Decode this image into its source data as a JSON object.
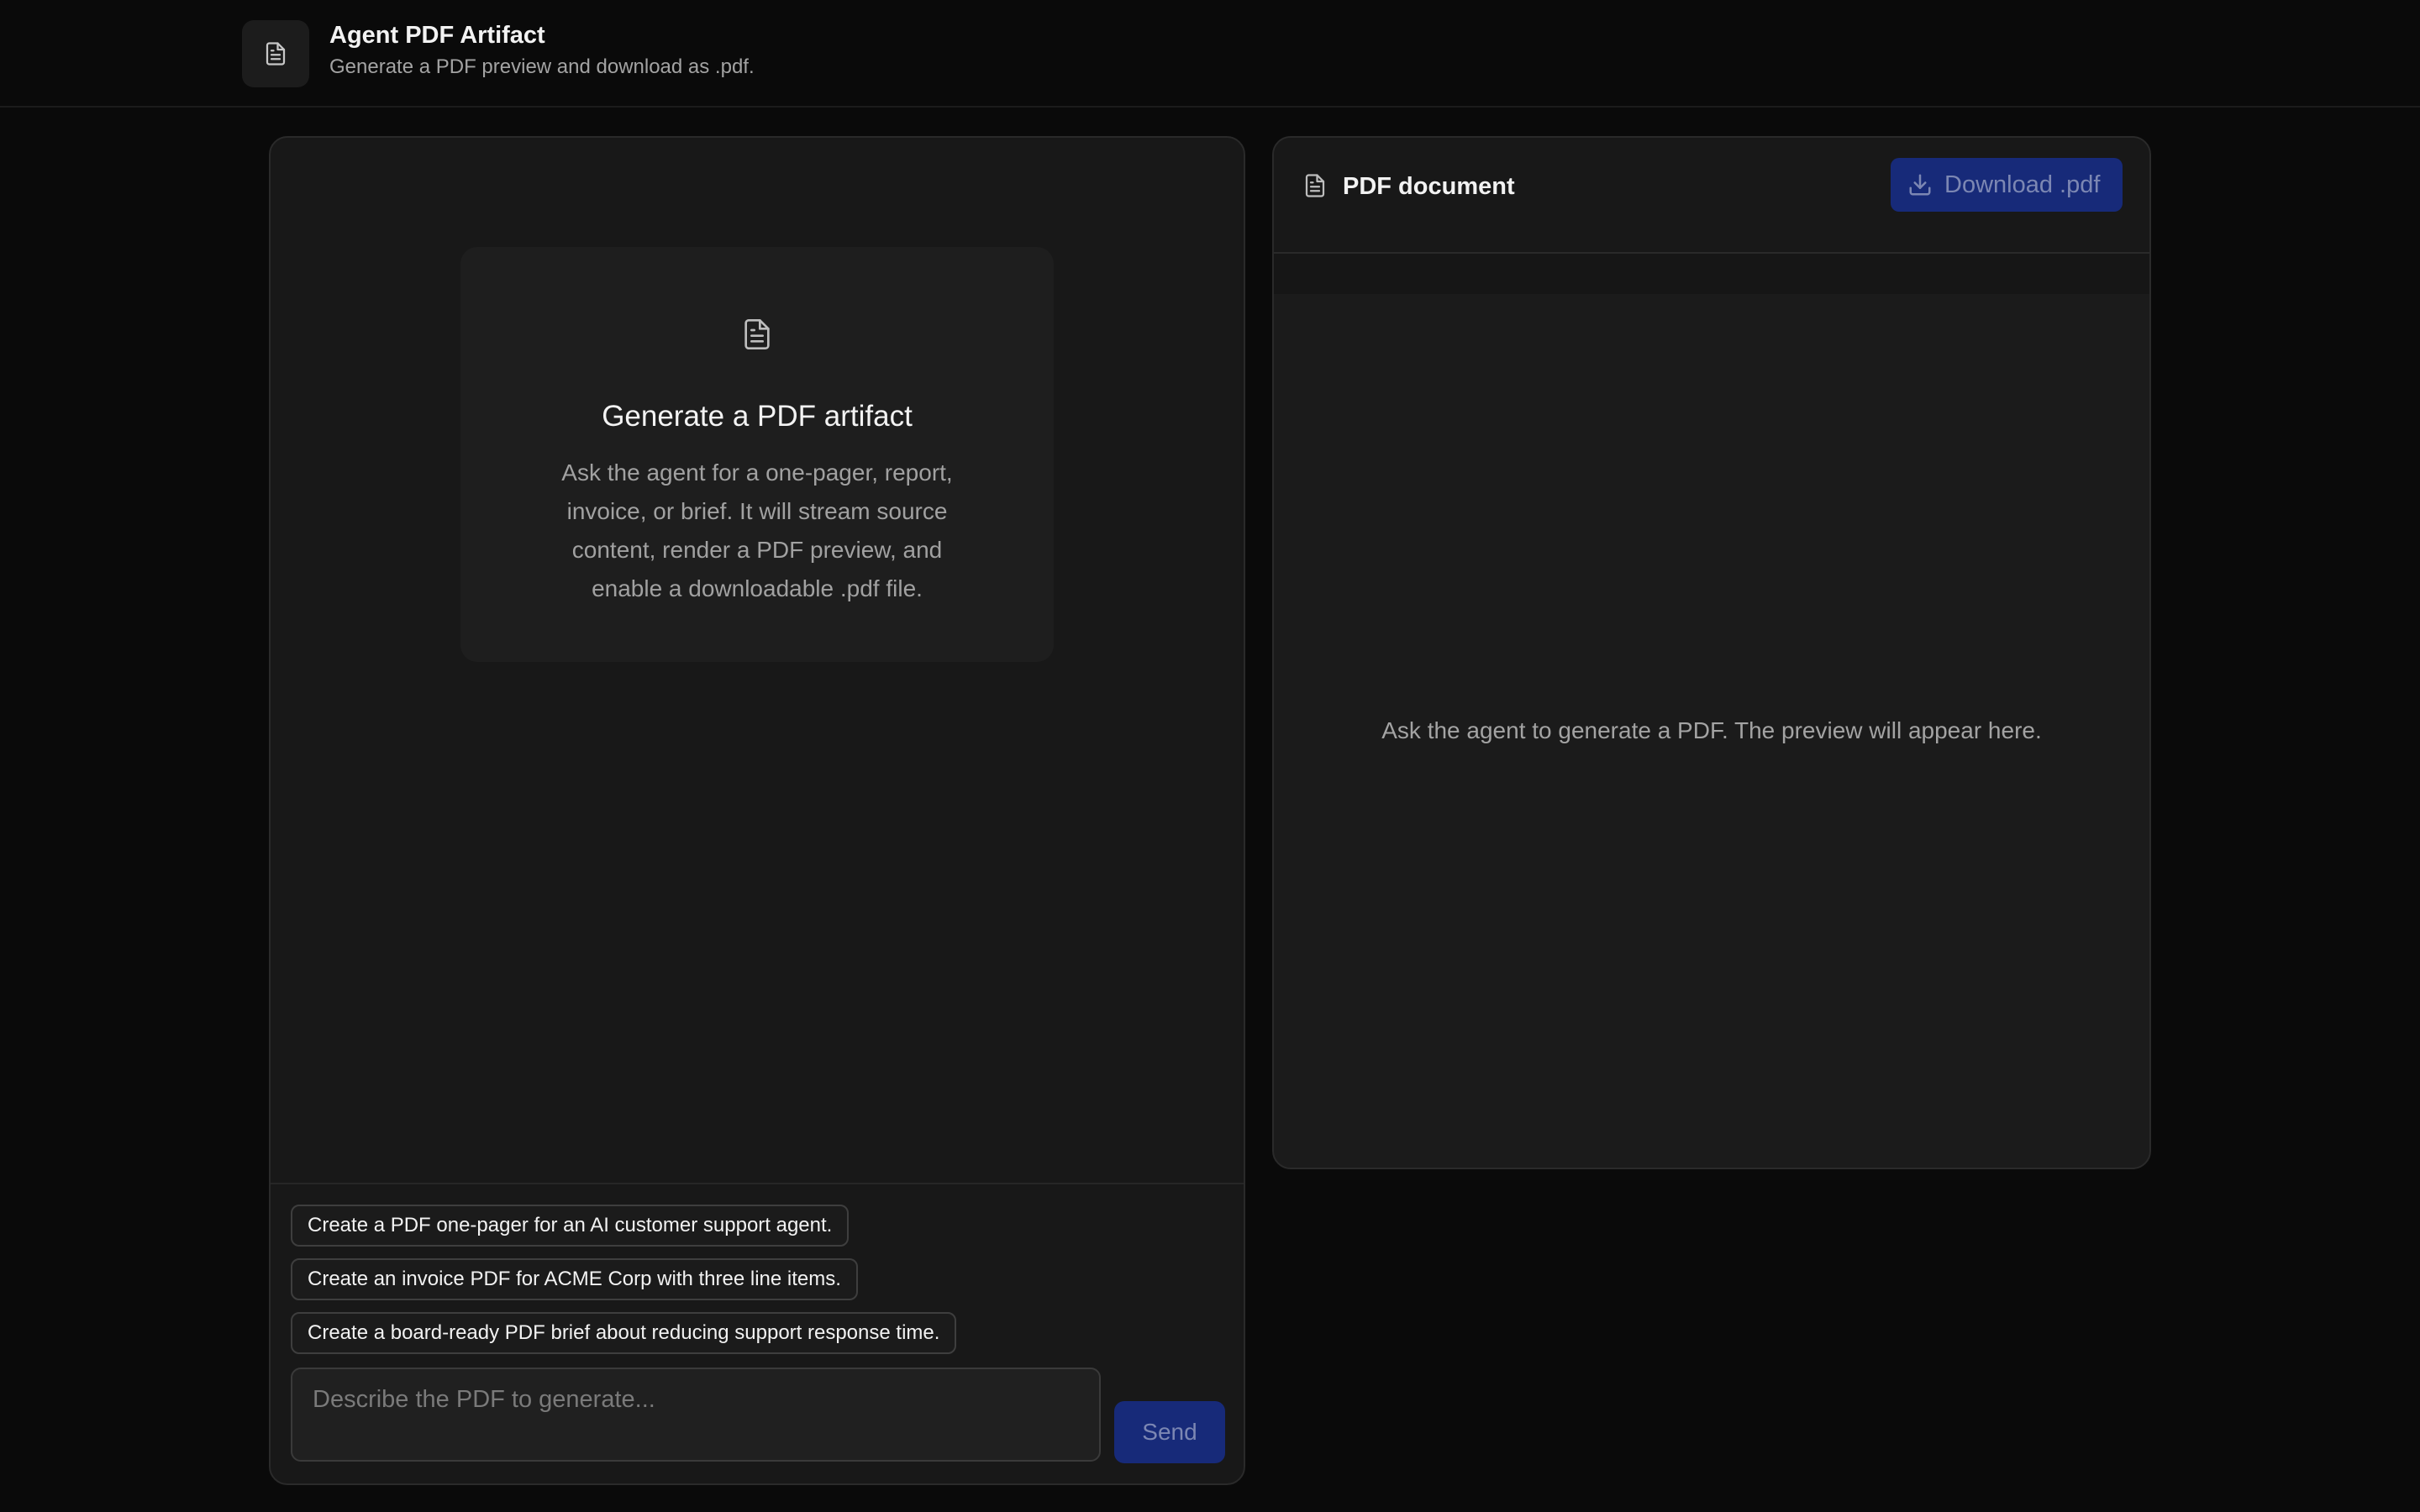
{
  "header": {
    "title": "Agent PDF Artifact",
    "subtitle": "Generate a PDF preview and download as .pdf.",
    "icon": "document-icon"
  },
  "chat": {
    "empty_state": {
      "icon": "document-icon",
      "title": "Generate a PDF artifact",
      "description": "Ask the agent for a one-pager, report, invoice, or brief. It will stream source content, render a PDF preview, and enable a downloadable .pdf file."
    },
    "suggestions": [
      "Create a PDF one-pager for an AI customer support agent.",
      "Create an invoice PDF for ACME Corp with three line items.",
      "Create a board-ready PDF brief about reducing support response time."
    ],
    "input": {
      "placeholder": "Describe the PDF to generate...",
      "value": ""
    },
    "send_label": "Send"
  },
  "pdf": {
    "title": "PDF document",
    "download_label": "Download .pdf",
    "placeholder": "Ask the agent to generate a PDF. The preview will appear here."
  },
  "colors": {
    "background": "#0a0a0a",
    "panel": "#181818",
    "accent_button": "#172a79",
    "accent_button_text": "#7c87b3"
  }
}
